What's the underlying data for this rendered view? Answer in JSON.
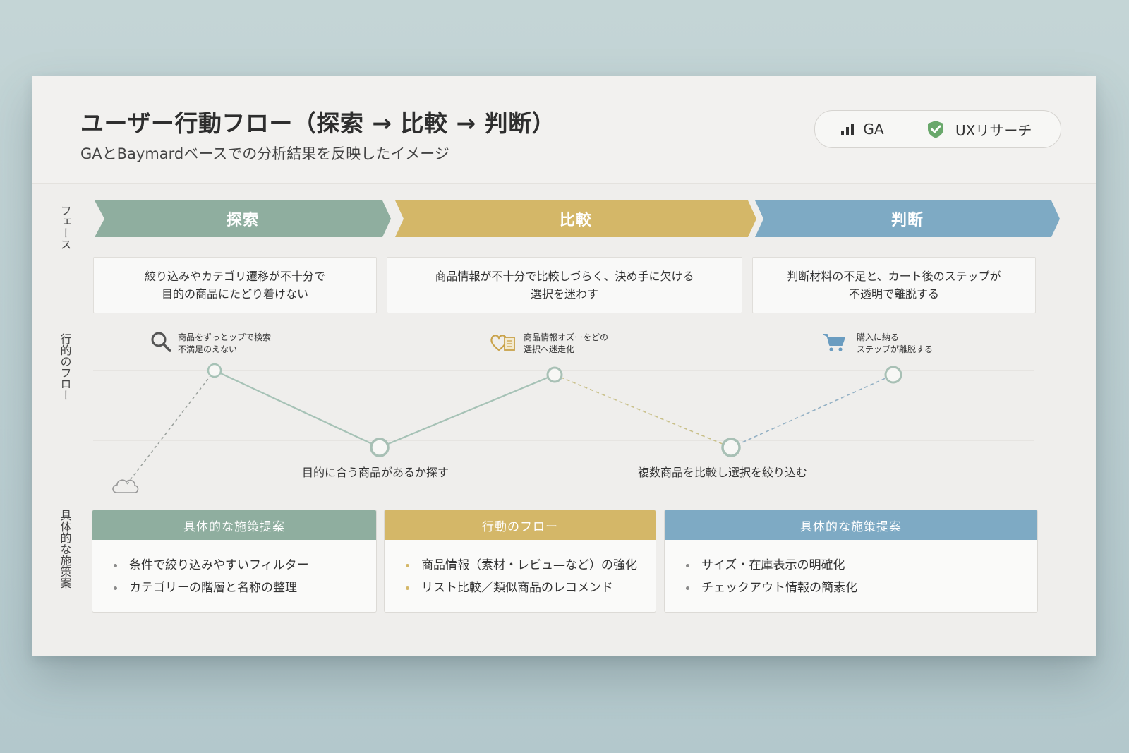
{
  "header": {
    "title": "ユーザー行動フロー（探索 → 比較 → 判断）",
    "subtitle": "GAとBaymardベースでの分析結果を反映したイメージ",
    "badges": [
      {
        "label": "GA",
        "icon": "bar-chart-icon"
      },
      {
        "label": "UXリサーチ",
        "icon": "check-shield-icon"
      }
    ]
  },
  "row_labels": {
    "phase": "フェース",
    "flow": "行的のフロー",
    "proposal": "具体的な施策案"
  },
  "phases": [
    {
      "label": "探索",
      "color": "#8fae9f",
      "desc_lines": [
        "絞り込みやカテゴリ遷移が不十分で",
        "目的の商品にたどり着けない"
      ]
    },
    {
      "label": "比較",
      "color": "#d4b768",
      "desc_lines": [
        "商品情報が不十分で比較しづらく、決め手に欠ける",
        "選択を迷わす"
      ]
    },
    {
      "label": "判断",
      "color": "#7eaac4",
      "desc_lines": [
        "判断材料の不足と、カート後のステップが",
        "不透明で離脱する"
      ]
    }
  ],
  "flow": {
    "notes": [
      {
        "icon": "search-icon",
        "lines": [
          "商品をずっとップで検索",
          "不満足のえない"
        ]
      },
      {
        "icon": "heart-document-icon",
        "lines": [
          "商品情報オズーをどの",
          "選択へ迷走化"
        ]
      },
      {
        "icon": "cart-icon",
        "lines": [
          "購入に納る",
          "ステップが離脱する"
        ]
      }
    ],
    "labels": [
      "目的に合う商品があるか探す",
      "複数商品を比較し選択を絞り込む"
    ]
  },
  "proposals": [
    {
      "title": "具体的な施策提案",
      "color": "#8fae9f",
      "bullet_color": "#8a8a8a",
      "items": [
        "条件で絞り込みやすいフィルター",
        "カテゴリーの階層と名称の整理"
      ]
    },
    {
      "title": "行動のフロー",
      "color": "#d4b768",
      "bullet_color": "#d4b768",
      "items": [
        "商品情報（素材・レビュ—など）の強化",
        "リスト比較／類似商品のレコメンド"
      ]
    },
    {
      "title": "具体的な施策提案",
      "color": "#7eaac4",
      "bullet_color": "#8a8a8a",
      "items": [
        "サイズ・在庫表示の明確化",
        "チェックアウト情報の簡素化"
      ]
    }
  ]
}
